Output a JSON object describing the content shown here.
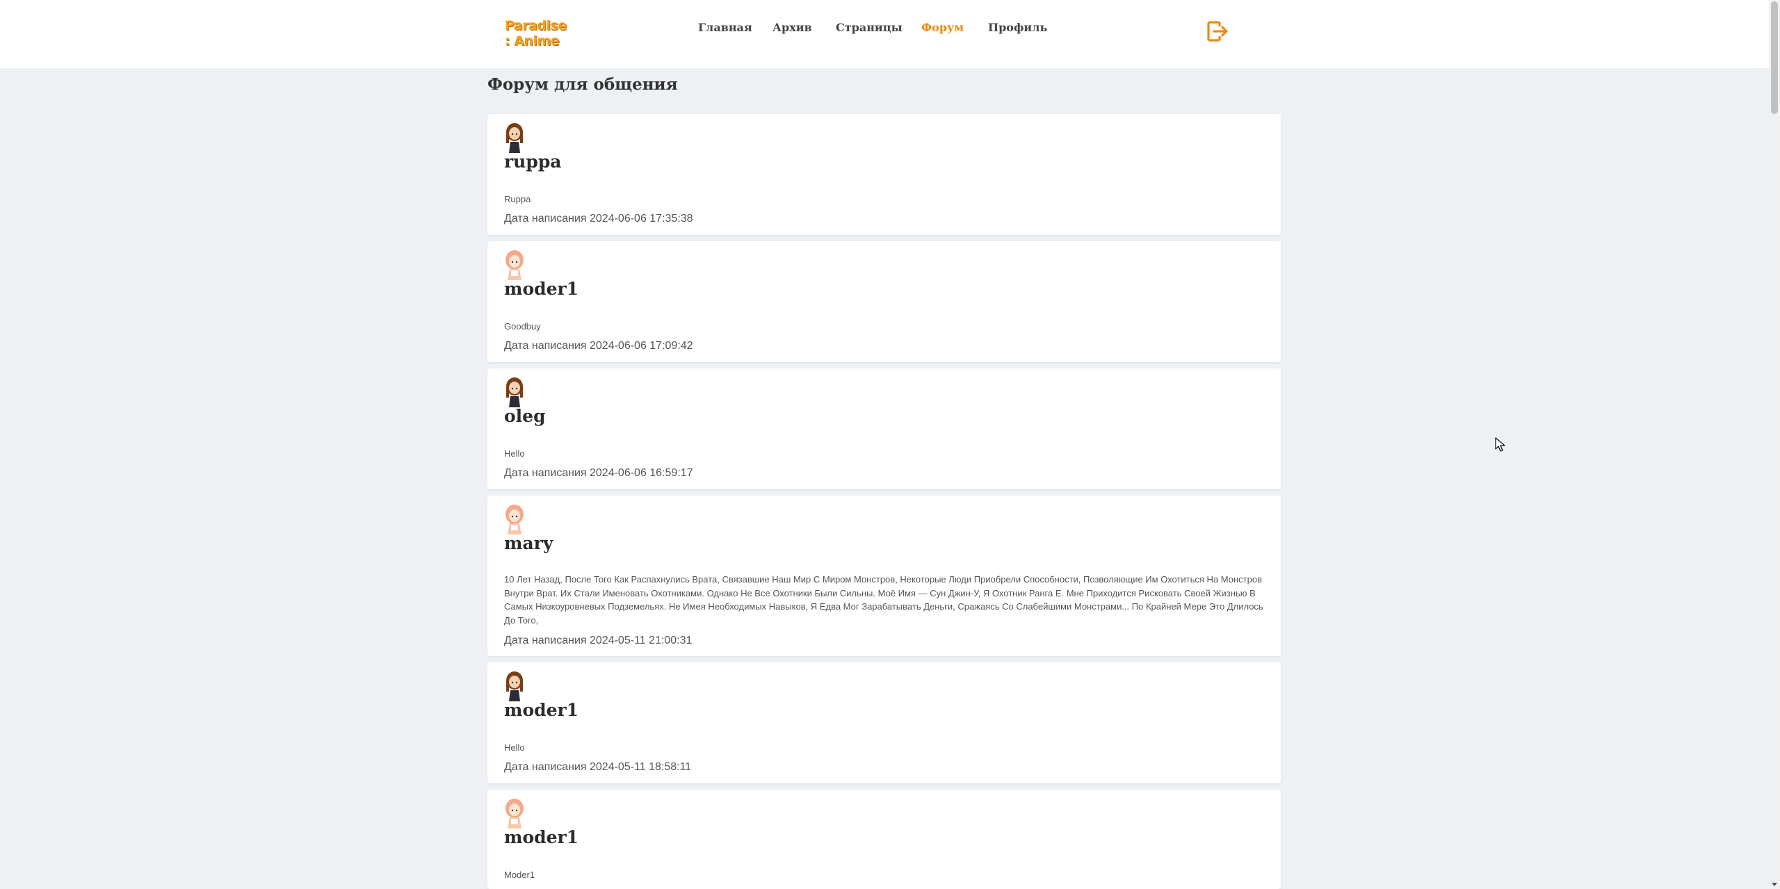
{
  "header": {
    "logo_line1": "Paradise",
    "logo_line2": ": Anime",
    "nav": [
      {
        "label": "Главная",
        "active": false
      },
      {
        "label": "Архив",
        "active": false
      },
      {
        "label": "Страницы",
        "active": false
      },
      {
        "label": "Форум",
        "active": true
      },
      {
        "label": "Профиль",
        "active": false
      }
    ],
    "logout_icon": "logout-icon",
    "accent_color": "#f08a10"
  },
  "page": {
    "title": "Форум для общения"
  },
  "posts": [
    {
      "username": "ruppa",
      "avatar": "avatar-brown-hair-girl",
      "message": "Ruppa",
      "date": "Дата написания 2024-06-06 17:35:38"
    },
    {
      "username": "moder1",
      "avatar": "avatar-orange-hood-girl",
      "message": "Goodbuy",
      "date": "Дата написания 2024-06-06 17:09:42"
    },
    {
      "username": "oleg",
      "avatar": "avatar-brown-hair-girl",
      "message": "Hello",
      "date": "Дата написания 2024-06-06 16:59:17"
    },
    {
      "username": "mary",
      "avatar": "avatar-orange-hood-girl",
      "message": "10 Лет Назад, После Того Как Распахнулись Врата, Связавшие Наш Мир С Миром Монстров, Некоторые Люди Приобрели Способности, Позволяющие Им Охотиться На Монстров Внутри Врат. Их Стали Именовать Охотниками. Однако Не Все Охотники Были Сильны. Моё Имя — Сун Джин-У, Я Охотник Ранга E. Мне Приходится Рисковать Своей Жизнью В Самых Низкоуровневых Подземельях. Не Имея Необходимых Навыков, Я Едва Мог Зарабатывать Деньги, Сражаясь Со Слабейшими Монстрами... По Крайней Мере Это Длилось До Того,",
      "date": "Дата написания 2024-05-11 21:00:31"
    },
    {
      "username": "moder1",
      "avatar": "avatar-brown-hair-girl",
      "message": "Hello",
      "date": "Дата написания 2024-05-11 18:58:11"
    },
    {
      "username": "moder1",
      "avatar": "avatar-orange-hood-girl",
      "message": "Moder1",
      "date": ""
    }
  ]
}
